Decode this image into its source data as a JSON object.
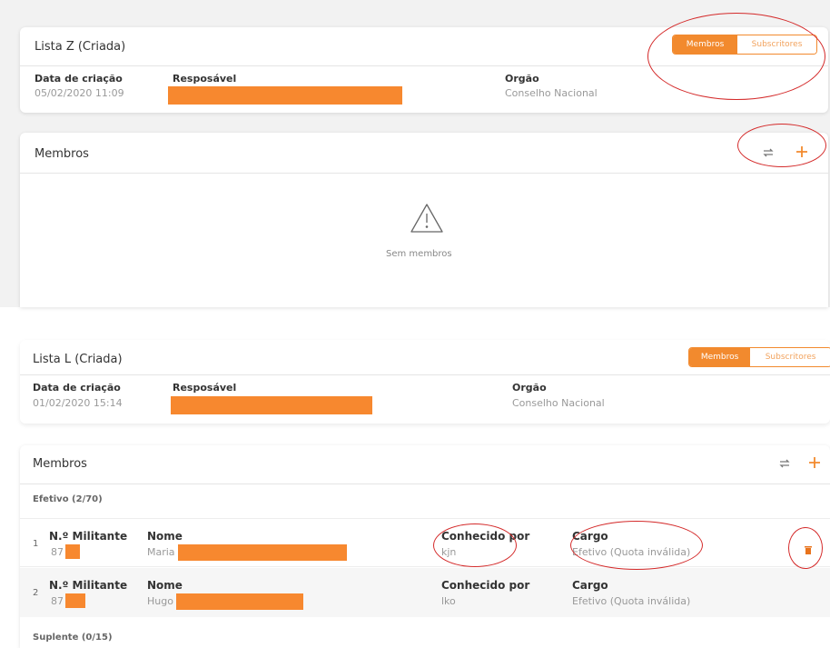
{
  "top": {
    "list": {
      "title": "Lista Z (Criada)",
      "segment": {
        "active": "Membros",
        "inactive": "Subscritores"
      },
      "creation_label": "Data de criação",
      "creation_value": "05/02/2020 11:09",
      "responsible_label": "Resposável",
      "organ_label": "Orgão",
      "organ_value": "Conselho Nacional"
    },
    "members": {
      "title": "Membros",
      "empty_text": "Sem membros"
    }
  },
  "bottom": {
    "list": {
      "title": "Lista L (Criada)",
      "segment": {
        "active": "Membros",
        "inactive": "Subscritores"
      },
      "creation_label": "Data de criação",
      "creation_value": "01/02/2020 15:14",
      "responsible_label": "Resposável",
      "organ_label": "Orgão",
      "organ_value": "Conselho Nacional"
    },
    "members": {
      "title": "Membros",
      "section_efetivo": "Efetivo (2/70)",
      "section_suplente": "Suplente (0/15)",
      "rows": [
        {
          "index": "1",
          "militante_label": "N.º Militante",
          "militante_value": "87",
          "nome_label": "Nome",
          "nome_value": "Maria",
          "conhecido_label": "Conhecido por",
          "conhecido_value": "kjn",
          "cargo_label": "Cargo",
          "cargo_value": "Efetivo (Quota inválida)"
        },
        {
          "index": "2",
          "militante_label": "N.º Militante",
          "militante_value": "87",
          "nome_label": "Nome",
          "nome_value": "Hugo",
          "conhecido_label": "Conhecido por",
          "conhecido_value": "lko",
          "cargo_label": "Cargo",
          "cargo_value": "Efetivo (Quota inválida)"
        }
      ]
    }
  },
  "colors": {
    "accent": "#f28a2e",
    "redaction": "#f7882f",
    "annotation": "#d42a2a"
  },
  "icons": [
    "swap-icon",
    "plus-icon",
    "warning-icon",
    "trash-icon"
  ]
}
